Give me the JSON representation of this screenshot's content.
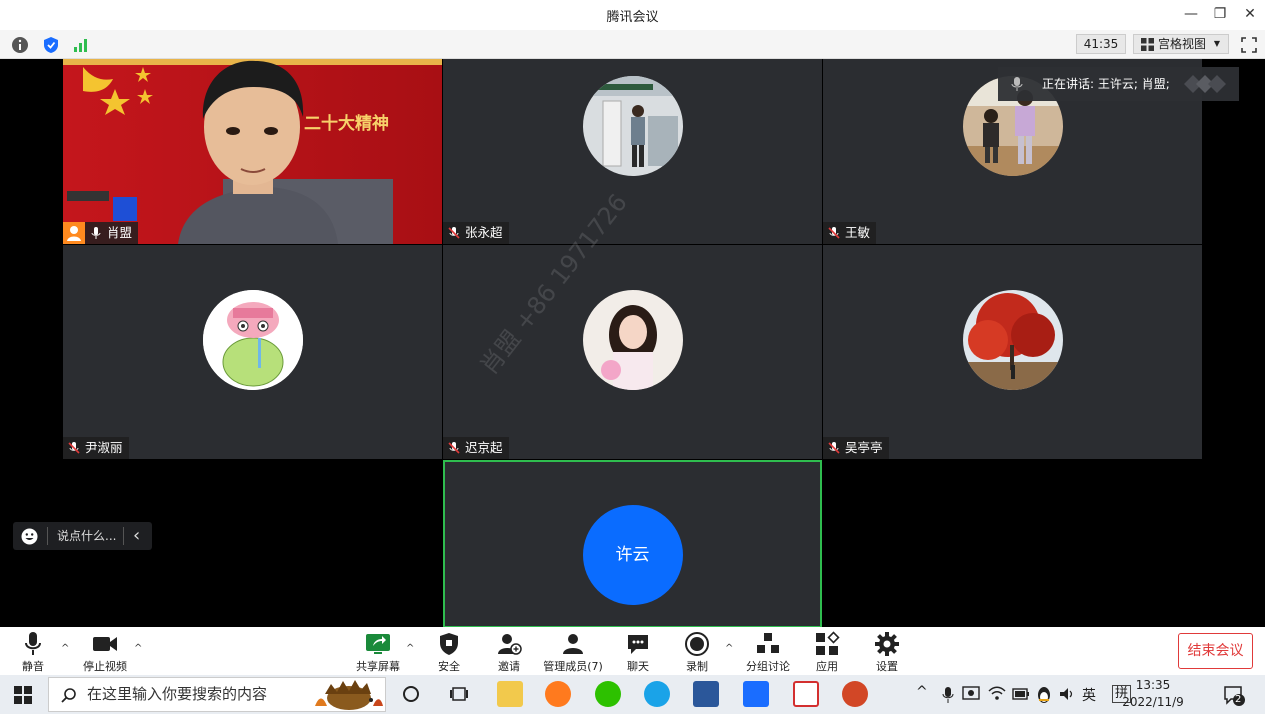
{
  "window": {
    "title": "腾讯会议",
    "minimize": "—",
    "restore": "❐",
    "close": "✕"
  },
  "statusbar": {
    "timer": "41:35",
    "view_label": "宫格视图",
    "view_caret": "▼"
  },
  "speaking": {
    "text": "正在讲话: 王许云; 肖盟;"
  },
  "participants": [
    {
      "name": "肖盟",
      "role": "speaker"
    },
    {
      "name": "张永超"
    },
    {
      "name": "王敏"
    },
    {
      "name": "尹淑丽"
    },
    {
      "name": "迟京起"
    },
    {
      "name": "吴亭亭"
    },
    {
      "name": "许云",
      "avatar_text": "许云"
    }
  ],
  "banner_text": "二十大精神",
  "watermark": "肖盟 +86 1971726",
  "chat": {
    "placeholder": "说点什么...",
    "chevron": "‹"
  },
  "toolbar": {
    "mute": "静音",
    "stop_video": "停止视频",
    "share_screen": "共享屏幕",
    "security": "安全",
    "invite": "邀请",
    "manage_members": "管理成员(7)",
    "chat": "聊天",
    "record": "录制",
    "breakout": "分组讨论",
    "apps": "应用",
    "settings": "设置",
    "end_meeting": "结束会议",
    "caret": "^"
  },
  "taskbar": {
    "search_placeholder": "在这里输入你要搜索的内容",
    "ime_lang": "英",
    "ime_mode": "拼",
    "time": "13:35",
    "date": "2022/11/9",
    "notif_count": "2"
  },
  "colors": {
    "accent_blue": "#0a6cff",
    "active_border": "#2fbd4f",
    "end_red": "#e03a3a",
    "tile_bg": "#2b2d31"
  }
}
